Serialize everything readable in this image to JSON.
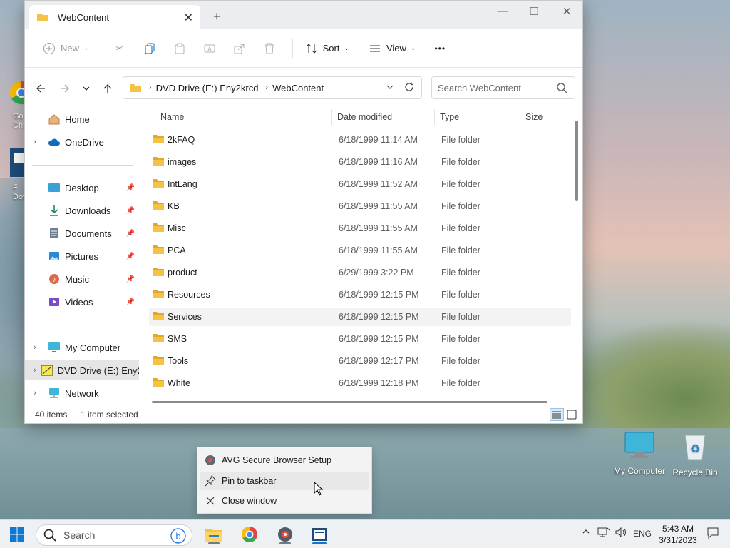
{
  "desktop": {
    "icons": [
      {
        "label": "My Computer"
      },
      {
        "label": "Recycle Bin"
      }
    ],
    "partial_icons": [
      {
        "label": "Go Chr"
      },
      {
        "label": "F Dov"
      }
    ]
  },
  "window": {
    "tab_title": "WebContent",
    "controls": {
      "minimize": "—",
      "maximize": "☐",
      "close": "✕"
    },
    "commands": {
      "new": "New",
      "sort": "Sort",
      "view": "View",
      "more": "•••"
    },
    "address": {
      "crumbs": [
        "DVD Drive (E:) Eny2krcd",
        "WebContent"
      ],
      "search_placeholder": "Search WebContent"
    },
    "nav": {
      "home": "Home",
      "onedrive": "OneDrive",
      "quick": [
        {
          "label": "Desktop"
        },
        {
          "label": "Downloads"
        },
        {
          "label": "Documents"
        },
        {
          "label": "Pictures"
        },
        {
          "label": "Music"
        },
        {
          "label": "Videos"
        }
      ],
      "my_computer": "My Computer",
      "dvd": "DVD Drive (E:) Eny2",
      "network": "Network"
    },
    "columns": {
      "name": "Name",
      "date": "Date modified",
      "type": "Type",
      "size": "Size"
    },
    "files": [
      {
        "name": "2kFAQ",
        "date": "6/18/1999 11:14 AM",
        "type": "File folder"
      },
      {
        "name": "images",
        "date": "6/18/1999 11:16 AM",
        "type": "File folder"
      },
      {
        "name": "IntLang",
        "date": "6/18/1999 11:52 AM",
        "type": "File folder"
      },
      {
        "name": "KB",
        "date": "6/18/1999 11:55 AM",
        "type": "File folder"
      },
      {
        "name": "Misc",
        "date": "6/18/1999 11:55 AM",
        "type": "File folder"
      },
      {
        "name": "PCA",
        "date": "6/18/1999 11:55 AM",
        "type": "File folder"
      },
      {
        "name": "product",
        "date": "6/29/1999 3:22 PM",
        "type": "File folder"
      },
      {
        "name": "Resources",
        "date": "6/18/1999 12:15 PM",
        "type": "File folder"
      },
      {
        "name": "Services",
        "date": "6/18/1999 12:15 PM",
        "type": "File folder"
      },
      {
        "name": "SMS",
        "date": "6/18/1999 12:15 PM",
        "type": "File folder"
      },
      {
        "name": "Tools",
        "date": "6/18/1999 12:17 PM",
        "type": "File folder"
      },
      {
        "name": "White",
        "date": "6/18/1999 12:18 PM",
        "type": "File folder"
      }
    ],
    "status": {
      "count": "40 items",
      "selected": "1 item selected"
    }
  },
  "jumplist": {
    "items": [
      {
        "label": "AVG Secure Browser Setup"
      },
      {
        "label": "Pin to taskbar"
      },
      {
        "label": "Close window"
      }
    ]
  },
  "taskbar": {
    "search_placeholder": "Search",
    "language": "ENG",
    "time": "5:43 AM",
    "date": "3/31/2023"
  },
  "colors": {
    "folder": "#f5c243",
    "folder_dark": "#e0a92a",
    "accent": "#0067c0"
  }
}
